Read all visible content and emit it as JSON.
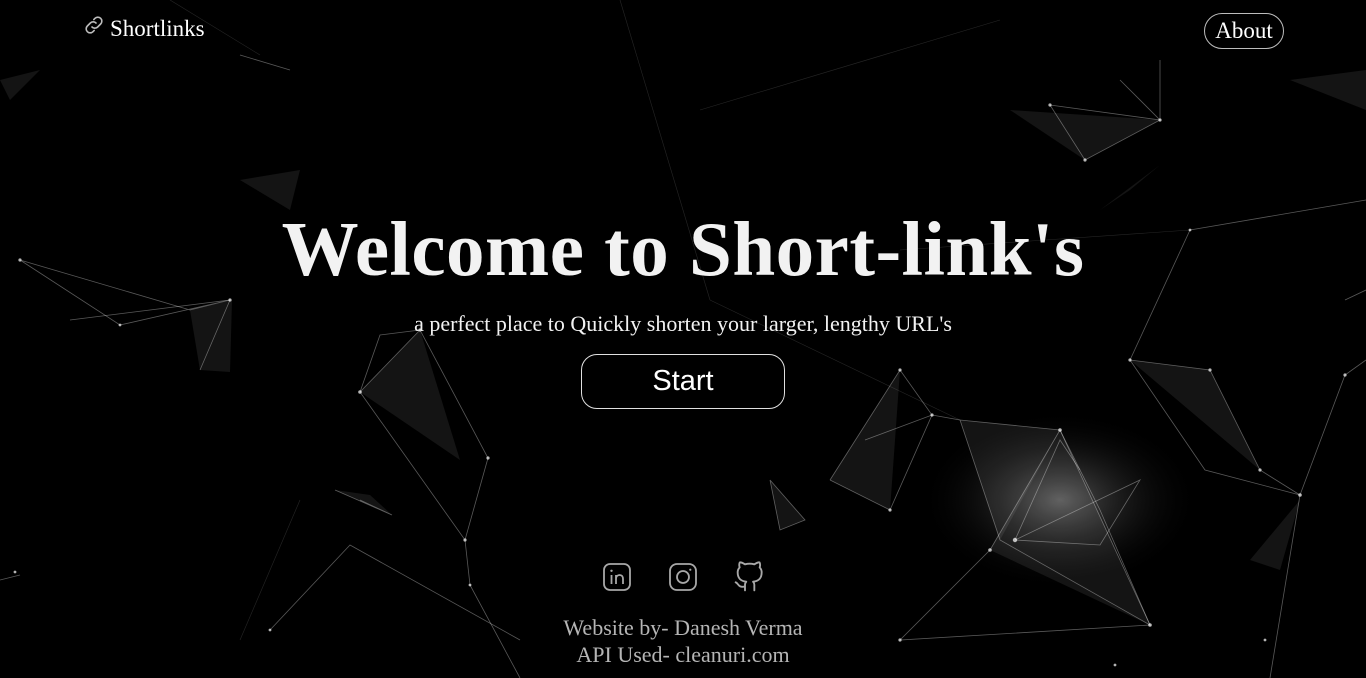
{
  "navbar": {
    "brand_label": "Shortlinks",
    "brand_icon": "link-icon",
    "about_label": "About"
  },
  "hero": {
    "title": "Welcome to Short-link's",
    "subtitle": "a perfect place to Quickly shorten your larger, lengthy URL's",
    "start_label": "Start"
  },
  "footer": {
    "socials": [
      {
        "icon": "linkedin-icon"
      },
      {
        "icon": "instagram-icon"
      },
      {
        "icon": "github-icon"
      }
    ],
    "credit": "Website by- Danesh Verma",
    "api": "API Used- cleanuri.com"
  },
  "colors": {
    "background": "#000000",
    "text": "#f2f2f2",
    "footer_text": "#b5b5b5",
    "border": "#bdbdbd"
  }
}
